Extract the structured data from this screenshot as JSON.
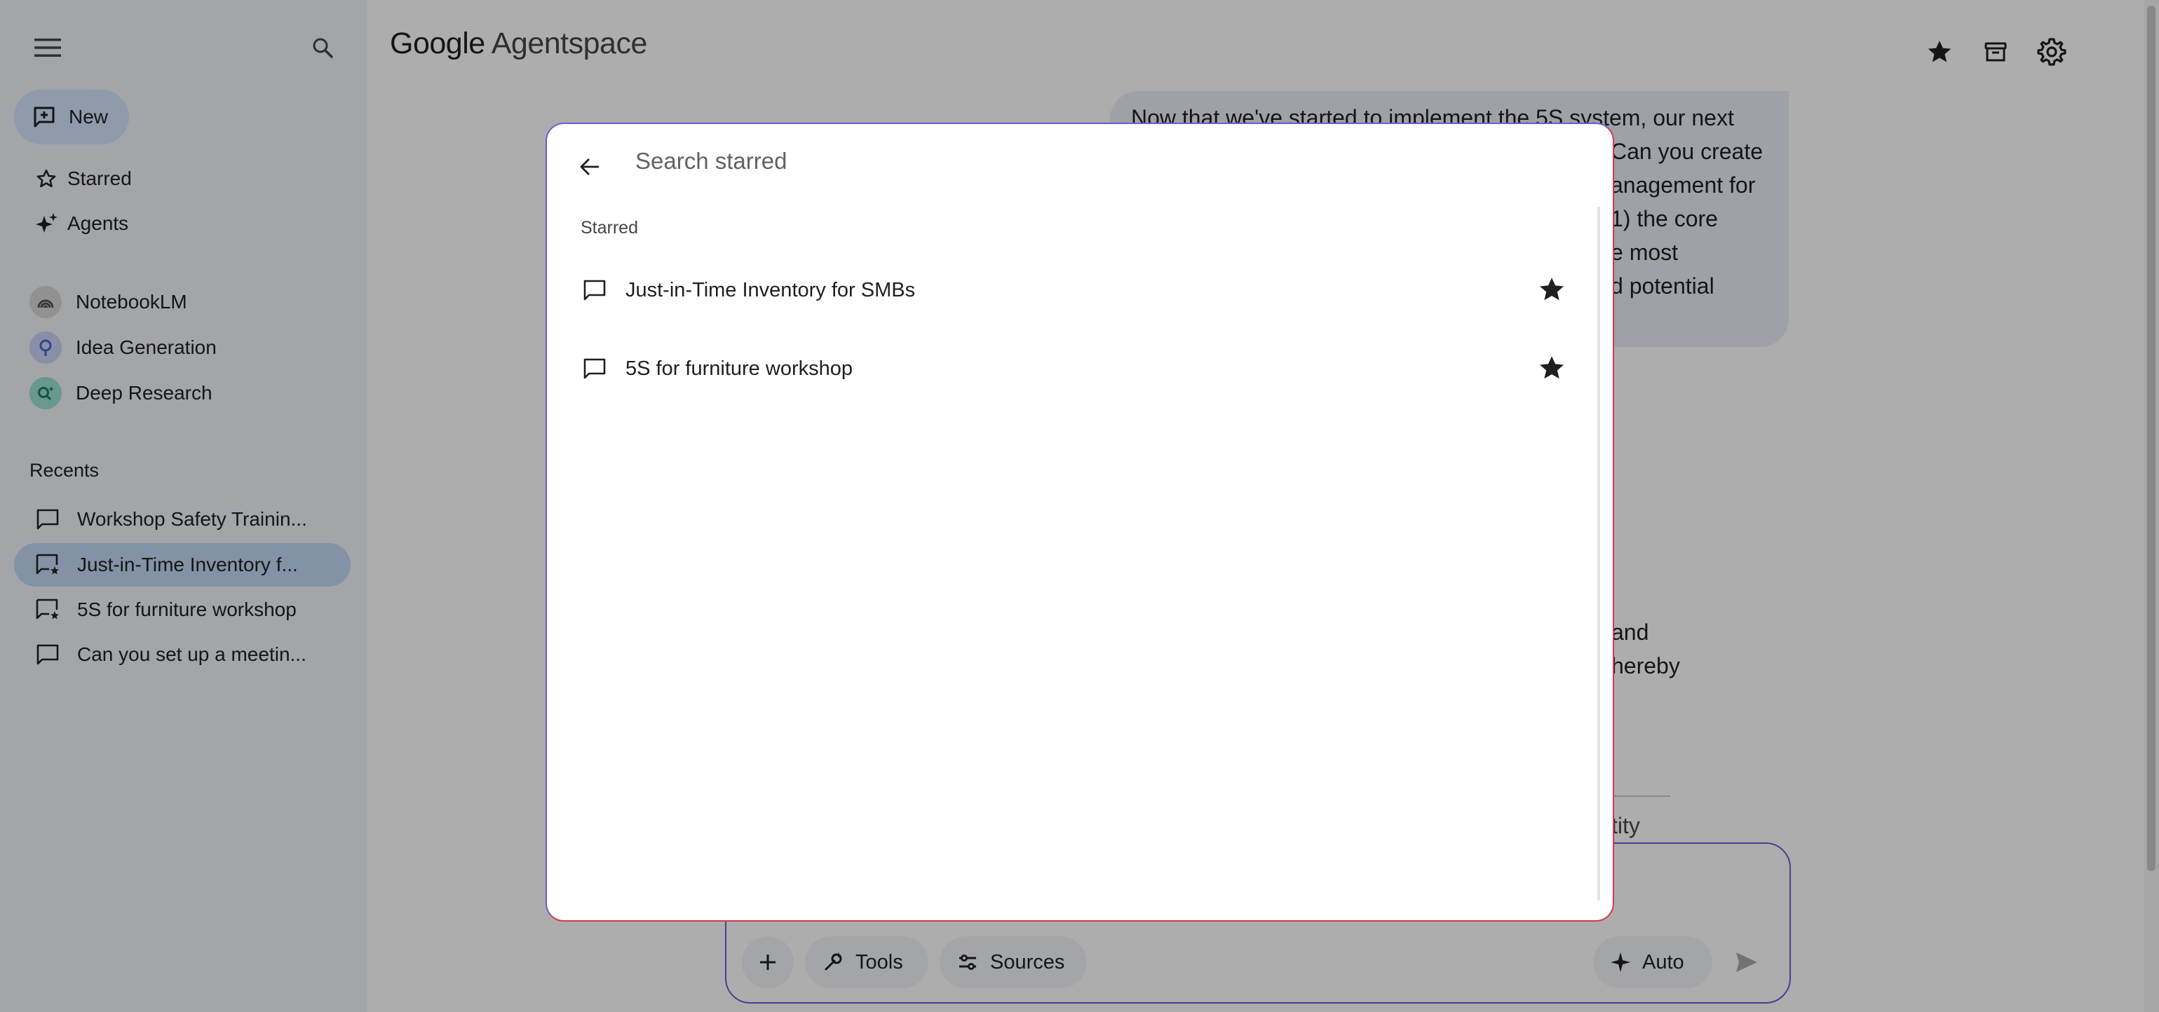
{
  "app": {
    "brand_google": "Google",
    "brand_product": "Agentspace"
  },
  "sidebar": {
    "new_label": "New",
    "nav": [
      {
        "label": "Starred",
        "icon": "star-outline-icon"
      },
      {
        "label": "Agents",
        "icon": "sparkle-agents-icon"
      }
    ],
    "agents": [
      {
        "label": "NotebookLM",
        "icon": "notebooklm-icon",
        "color": "#8a8a8a"
      },
      {
        "label": "Idea Generation",
        "icon": "lightbulb-icon",
        "color": "#7b8ed6"
      },
      {
        "label": "Deep Research",
        "icon": "deep-research-icon",
        "color": "#4fb6a4"
      }
    ],
    "recents_title": "Recents",
    "recents": [
      {
        "label": "Workshop Safety Trainin...",
        "starred": false
      },
      {
        "label": "Just-in-Time Inventory f...",
        "starred": true,
        "active": true
      },
      {
        "label": "5S for furniture workshop",
        "starred": true
      },
      {
        "label": "Can you set up a meetin...",
        "starred": false
      }
    ]
  },
  "chat": {
    "bubble_lines": [
      "Now that we've started to implement the 5S system, our next",
      "Can you create",
      "anagement for",
      "1) the core",
      "e most",
      "d potential"
    ],
    "peek_lines": [
      "and",
      "hereby",
      "tity"
    ]
  },
  "composer": {
    "tools_label": "Tools",
    "sources_label": "Sources",
    "auto_label": "Auto"
  },
  "dialog": {
    "search_placeholder": "Search starred",
    "section_label": "Starred",
    "items": [
      {
        "label": "Just-in-Time Inventory for SMBs"
      },
      {
        "label": "5S for furniture workshop"
      }
    ]
  },
  "colors": {
    "accent_blue_soft": "#d3e3fd",
    "active_row": "#c2d7f5",
    "sidebar_bg": "#f0f4f9",
    "dialog_border_top": "#6d5bd9",
    "dialog_border_bottom": "#d93848"
  }
}
